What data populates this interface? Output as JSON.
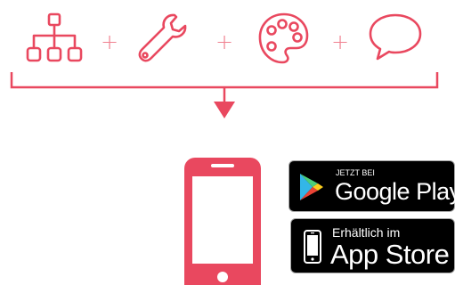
{
  "colors": {
    "accent": "#e9485f",
    "plus": "#f08090",
    "badge_bg": "#000000",
    "badge_text": "#ffffff"
  },
  "features": {
    "icons": [
      "sitemap-icon",
      "wrench-icon",
      "palette-icon",
      "speech-bubble-icon"
    ],
    "separator": "+"
  },
  "phone": {
    "icon": "smartphone-icon"
  },
  "google_play": {
    "small_text": "JETZT BEI",
    "big_text": "Google Play",
    "icon": "google-play-icon"
  },
  "app_store": {
    "small_text": "Erhältlich im",
    "big_text": "App Store",
    "icon": "iphone-icon"
  }
}
